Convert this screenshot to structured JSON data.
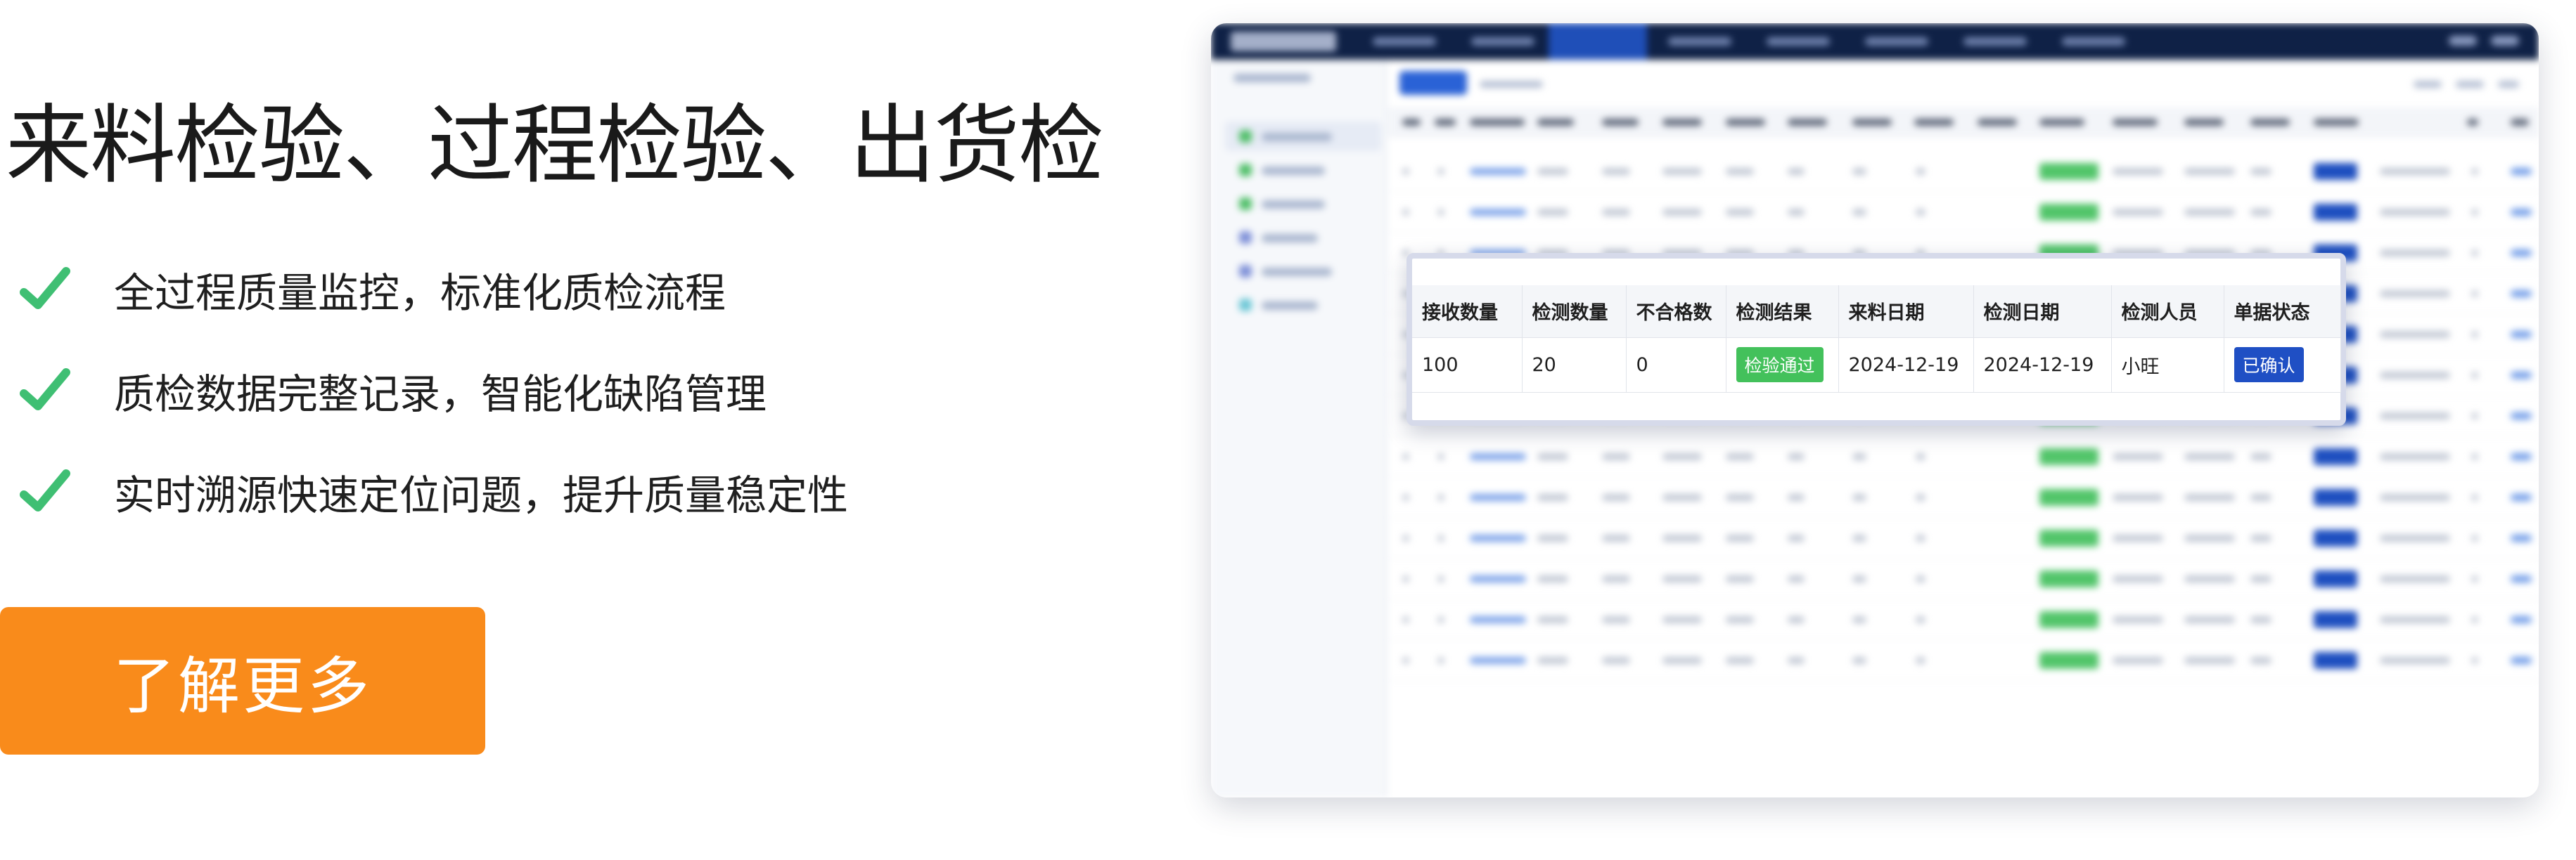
{
  "hero": {
    "headline": "来料检验、过程检验、出货检",
    "features": [
      "全过程质量监控，标准化质检流程",
      "质检数据完整记录，智能化缺陷管理",
      "实时溯源快速定位问题，提升质量稳定性"
    ],
    "cta_label": "了解更多"
  },
  "detail_table": {
    "headers": [
      "接收数量",
      "检测数量",
      "不合格数",
      "检测结果",
      "来料日期",
      "检测日期",
      "检测人员",
      "单据状态"
    ],
    "row": {
      "received_qty": "100",
      "inspected_qty": "20",
      "defect_qty": "0",
      "result": "检验通过",
      "arrival_date": "2024-12-19",
      "inspection_date": "2024-12-19",
      "inspector": "小旺",
      "status": "已确认"
    }
  },
  "colors": {
    "cta": "#f98b1b",
    "check": "#3fbf73",
    "nav_dark": "#0f2146",
    "pass_green": "#43c15b",
    "status_blue": "#1f4fc4"
  },
  "icons": {
    "feature_check": "check-icon"
  }
}
